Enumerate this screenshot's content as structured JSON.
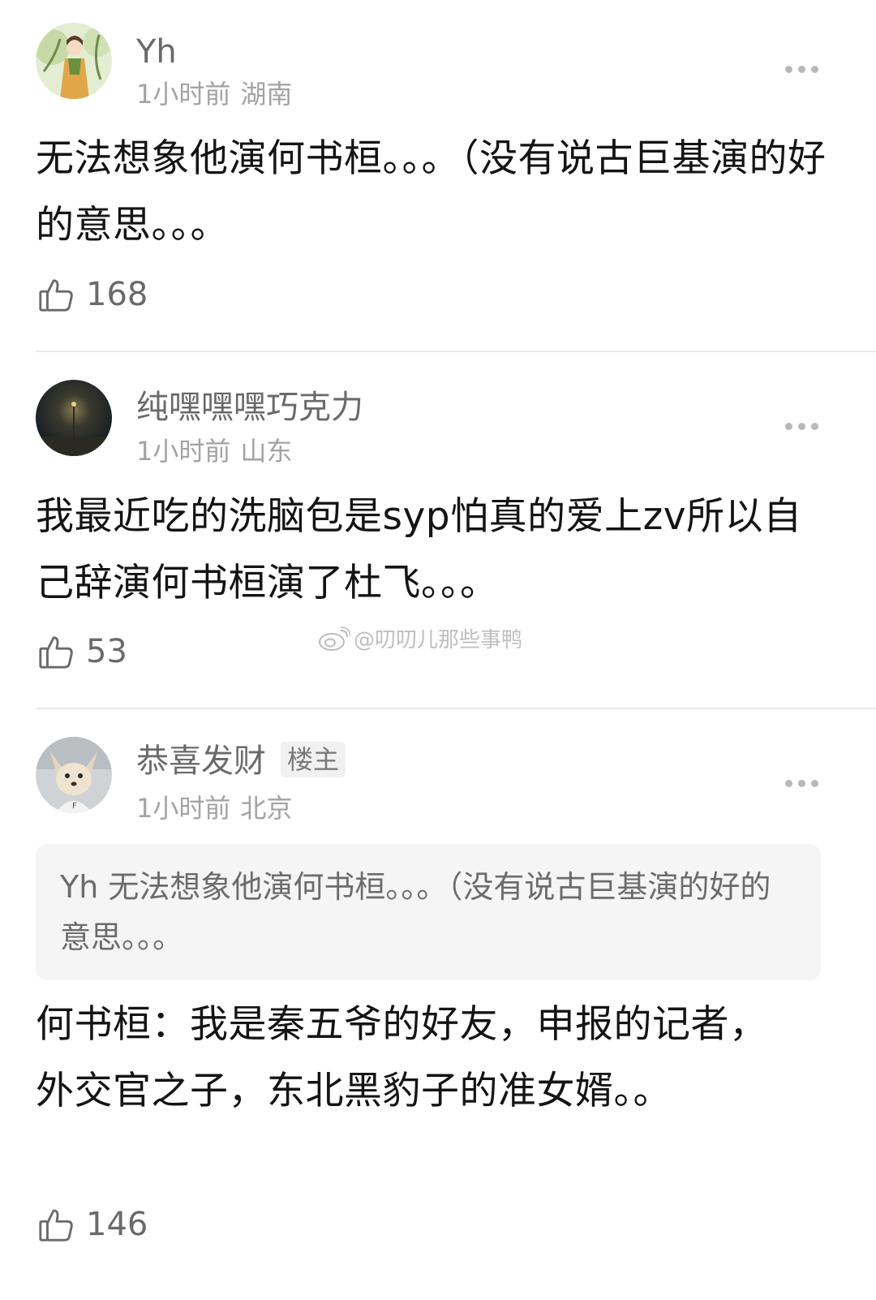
{
  "comments": [
    {
      "username": "Yh",
      "time": "1小时前",
      "location": "湖南",
      "text": "无法想象他演何书桓。。。（没有说古巨基演的好的意思。。。",
      "likes": "168"
    },
    {
      "username": "纯嘿嘿嘿巧克力",
      "time": "1小时前",
      "location": "山东",
      "text": "我最近吃的洗脑包是syp怕真的爱上zv所以自己辞演何书桓演了杜飞。。。",
      "likes": "53"
    },
    {
      "username": "恭喜发财",
      "badge": "楼主",
      "time": "1小时前",
      "location": "北京",
      "quote": "Yh 无法想象他演何书桓。。。（没有说古巨基演的好的意思。。。",
      "text": "何书桓：我是秦五爷的好友，申报的记者，外交官之子，东北黑豹子的准女婿。。",
      "likes": "146"
    }
  ],
  "watermark": "@叨叨儿那些事鸭",
  "icons": {
    "like": "thumbs-up-icon",
    "more": "more-dots-icon",
    "weibo": "weibo-logo-icon"
  }
}
